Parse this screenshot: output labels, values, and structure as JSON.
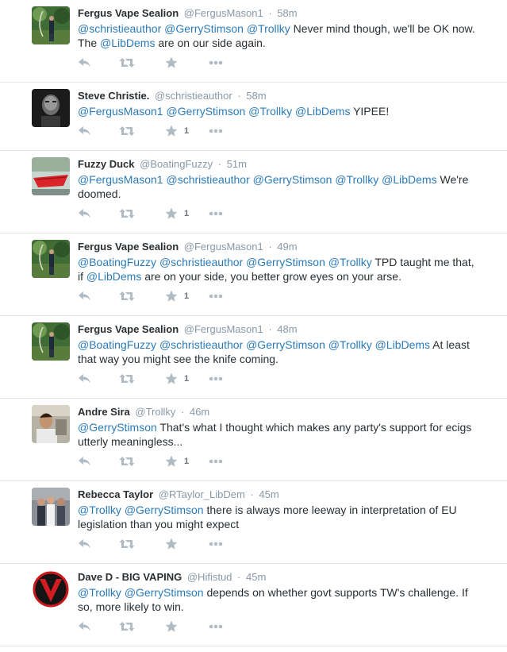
{
  "tweets": [
    {
      "name": "Fergus Vape Sealion",
      "handle": "@FergusMason1",
      "time": "58m",
      "avatar": "archer",
      "segments": [
        {
          "t": "@schristieauthor",
          "link": true
        },
        {
          "t": " "
        },
        {
          "t": "@GerryStimson",
          "link": true
        },
        {
          "t": " "
        },
        {
          "t": "@Trollky",
          "link": true
        },
        {
          "t": " Never mind though, we'll be OK now. The "
        },
        {
          "t": "@LibDems",
          "link": true
        },
        {
          "t": " are on our side again."
        }
      ],
      "fav_count": ""
    },
    {
      "name": "Steve Christie.",
      "handle": "@schristieauthor",
      "time": "58m",
      "avatar": "dark-portrait",
      "segments": [
        {
          "t": "@FergusMason1",
          "link": true
        },
        {
          "t": " "
        },
        {
          "t": "@GerryStimson",
          "link": true
        },
        {
          "t": " "
        },
        {
          "t": "@Trollky",
          "link": true
        },
        {
          "t": " "
        },
        {
          "t": "@LibDems",
          "link": true
        },
        {
          "t": " YIPEE!"
        }
      ],
      "fav_count": "1"
    },
    {
      "name": "Fuzzy Duck",
      "handle": "@BoatingFuzzy",
      "time": "51m",
      "avatar": "red-boat",
      "segments": [
        {
          "t": "@FergusMason1",
          "link": true
        },
        {
          "t": " "
        },
        {
          "t": "@schristieauthor",
          "link": true
        },
        {
          "t": " "
        },
        {
          "t": "@GerryStimson",
          "link": true
        },
        {
          "t": " "
        },
        {
          "t": "@Trollky",
          "link": true
        },
        {
          "t": " "
        },
        {
          "t": "@LibDems",
          "link": true
        },
        {
          "t": " We're doomed."
        }
      ],
      "fav_count": "1"
    },
    {
      "name": "Fergus Vape Sealion",
      "handle": "@FergusMason1",
      "time": "49m",
      "avatar": "archer",
      "segments": [
        {
          "t": "@BoatingFuzzy",
          "link": true
        },
        {
          "t": " "
        },
        {
          "t": "@schristieauthor",
          "link": true
        },
        {
          "t": " "
        },
        {
          "t": "@GerryStimson",
          "link": true
        },
        {
          "t": " "
        },
        {
          "t": "@Trollky",
          "link": true
        },
        {
          "t": " TPD taught me that, if "
        },
        {
          "t": "@LibDems",
          "link": true
        },
        {
          "t": " are on your side, you better grow eyes on your arse."
        }
      ],
      "fav_count": "1"
    },
    {
      "name": "Fergus Vape Sealion",
      "handle": "@FergusMason1",
      "time": "48m",
      "avatar": "archer",
      "segments": [
        {
          "t": "@BoatingFuzzy",
          "link": true
        },
        {
          "t": " "
        },
        {
          "t": "@schristieauthor",
          "link": true
        },
        {
          "t": " "
        },
        {
          "t": "@GerryStimson",
          "link": true
        },
        {
          "t": " "
        },
        {
          "t": "@Trollky",
          "link": true
        },
        {
          "t": " "
        },
        {
          "t": "@LibDems",
          "link": true
        },
        {
          "t": " At least that way you might see the knife coming."
        }
      ],
      "fav_count": "1"
    },
    {
      "name": "Andre Sira",
      "handle": "@Trollky",
      "time": "46m",
      "avatar": "man-portrait",
      "segments": [
        {
          "t": "@GerryStimson",
          "link": true
        },
        {
          "t": " That's what I thought which makes any party's support for ecigs utterly meaningless..."
        }
      ],
      "fav_count": "1"
    },
    {
      "name": "Rebecca Taylor",
      "handle": "@RTaylor_LibDem",
      "time": "45m",
      "avatar": "group-photo",
      "segments": [
        {
          "t": "@Trollky",
          "link": true
        },
        {
          "t": " "
        },
        {
          "t": "@GerryStimson",
          "link": true
        },
        {
          "t": " there is always more leeway in interpretation of EU legislation than you might expect"
        }
      ],
      "fav_count": ""
    },
    {
      "name": "Dave D - BIG VAPING",
      "handle": "@Hifistud",
      "time": "45m",
      "avatar": "v-logo",
      "segments": [
        {
          "t": "@Trollky",
          "link": true
        },
        {
          "t": " "
        },
        {
          "t": "@GerryStimson",
          "link": true
        },
        {
          "t": " depends on whether govt supports TW's challenge. If so, more likely to win."
        }
      ],
      "fav_count": ""
    }
  ],
  "separator": "·",
  "colors": {
    "link": "#2b7bb9",
    "name": "#292f33",
    "meta": "#8899a6",
    "action_icon": "#b1bbc3",
    "divider": "#e1e8ed"
  },
  "icons": {
    "reply": "reply-icon",
    "retweet": "retweet-icon",
    "favorite": "star-icon",
    "more": "more-icon"
  }
}
